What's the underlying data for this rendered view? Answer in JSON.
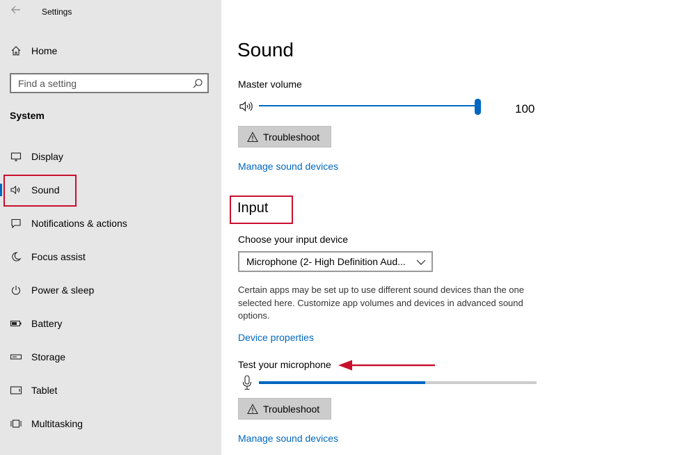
{
  "window": {
    "title": "Settings"
  },
  "sidebar": {
    "home_label": "Home",
    "search_placeholder": "Find a setting",
    "section_label": "System",
    "items": [
      {
        "label": "Display",
        "icon": "monitor-icon"
      },
      {
        "label": "Sound",
        "icon": "speaker-icon",
        "selected": true
      },
      {
        "label": "Notifications & actions",
        "icon": "notification-icon"
      },
      {
        "label": "Focus assist",
        "icon": "moon-icon"
      },
      {
        "label": "Power & sleep",
        "icon": "power-icon"
      },
      {
        "label": "Battery",
        "icon": "battery-icon"
      },
      {
        "label": "Storage",
        "icon": "storage-icon"
      },
      {
        "label": "Tablet",
        "icon": "tablet-icon"
      },
      {
        "label": "Multitasking",
        "icon": "multitasking-icon"
      }
    ]
  },
  "main": {
    "title": "Sound",
    "master_volume_label": "Master volume",
    "master_volume_value": "100",
    "master_volume_fraction": 1.0,
    "troubleshoot_label": "Troubleshoot",
    "manage_link": "Manage sound devices",
    "input_heading": "Input",
    "choose_input_label": "Choose your input device",
    "input_device_value": "Microphone (2- High Definition Aud...",
    "description": "Certain apps may be set up to use different sound devices than the one selected here. Customize app volumes and devices in advanced sound options.",
    "device_properties_link": "Device properties",
    "test_mic_label": "Test your microphone",
    "mic_level_fraction": 0.6
  },
  "colors": {
    "accent": "#0067c0",
    "highlight": "#c8102e",
    "sidebar_bg": "#e6e6e6"
  }
}
